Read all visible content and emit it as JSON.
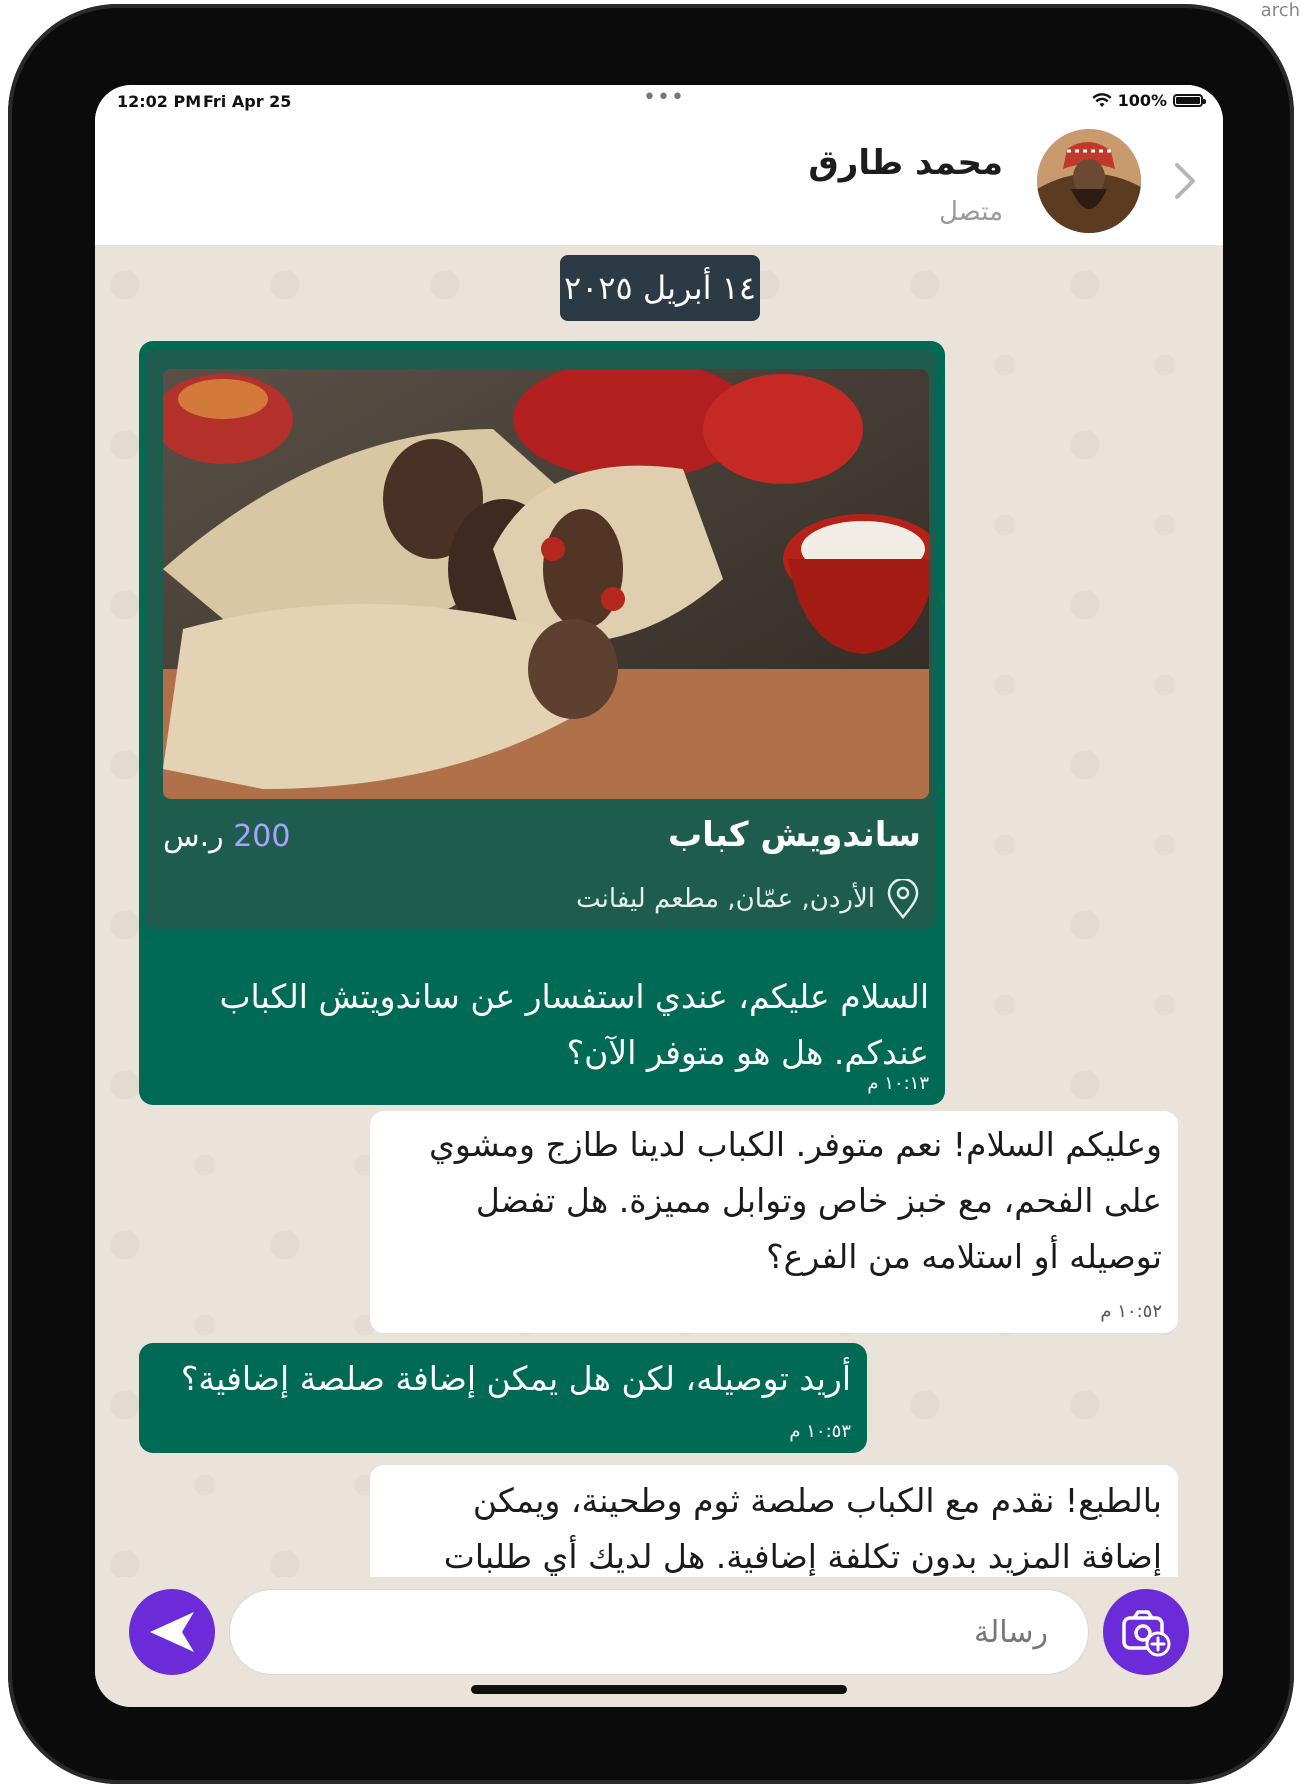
{
  "corner": {
    "text": "arch"
  },
  "status_bar": {
    "time": "12:02 PM",
    "date": "Fri Apr 25",
    "dots": "•••",
    "battery": "100%"
  },
  "header": {
    "contact_name": "محمد طارق",
    "status": "متصل"
  },
  "chat": {
    "date_chip": "١٤ أبريل ٢٠٢٥",
    "product_card": {
      "name": "ساندويش كباب",
      "price_value": "200",
      "price_currency": "ر.س",
      "location": "الأردن, عمّان, مطعم ليفانت"
    },
    "messages": [
      {
        "direction": "out",
        "lines": [
          "السلام عليكم، عندي استفسار عن ساندويتش الكباب",
          "عندكم. هل هو متوفر الآن؟"
        ],
        "time": "١٠:١٣ م"
      },
      {
        "direction": "in",
        "lines": [
          "وعليكم السلام! نعم متوفر. الكباب لدينا طازج ومشوي",
          "على الفحم، مع خبز خاص وتوابل مميزة. هل تفضل",
          "توصيله أو استلامه من الفرع؟"
        ],
        "time": "١٠:٥٢ م"
      },
      {
        "direction": "out",
        "lines": [
          "أريد توصيله، لكن هل يمكن إضافة صلصة إضافية؟"
        ],
        "time": "١٠:٥٣ م"
      },
      {
        "direction": "in",
        "lines": [
          "بالطبع! نقدم مع الكباب صلصة ثوم وطحينة، ويمكن",
          "إضافة المزيد بدون تكلفة إضافية. هل لديك أي طلبات"
        ],
        "time": ""
      }
    ]
  },
  "input": {
    "placeholder": "رسالة",
    "value": ""
  },
  "icons": {
    "send": "send-arrow-icon",
    "camera": "camera-plus-icon",
    "back": "chevron-right-icon",
    "location": "map-pin-icon"
  },
  "colors": {
    "outgoing_bubble": "#006a55",
    "accent": "#6c2bd9",
    "incoming_bubble": "#ffffff",
    "chat_bg": "#e9e3da",
    "price": "#a9a2ff"
  }
}
